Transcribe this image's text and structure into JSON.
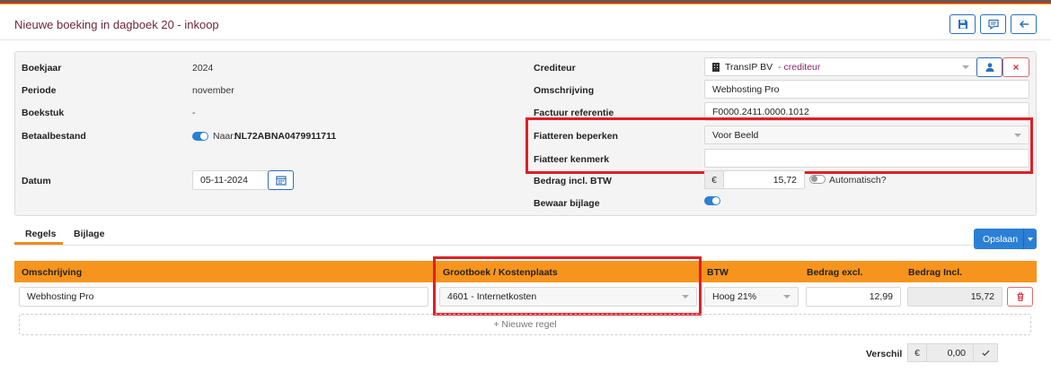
{
  "header": {
    "title": "Nieuwe boeking in dagboek 20  - inkoop"
  },
  "form": {
    "boekjaar": {
      "label": "Boekjaar",
      "value": "2024"
    },
    "periode": {
      "label": "Periode",
      "value": "november"
    },
    "boekstuk": {
      "label": "Boekstuk",
      "value": "-"
    },
    "betaalbestand": {
      "label": "Betaalbestand",
      "prefix": "Naar:",
      "value": "NL72ABNA0479911711"
    },
    "datum": {
      "label": "Datum",
      "value": "05-11-2024"
    },
    "crediteur": {
      "label": "Crediteur",
      "name": "TransIP BV",
      "suffix": "- crediteur"
    },
    "omschrijving": {
      "label": "Omschrijving",
      "value": "Webhosting Pro"
    },
    "factuur_referentie": {
      "label": "Factuur referentie",
      "value": "F0000.2411.0000.1012"
    },
    "fiatteren_beperken": {
      "label": "Fiatteren beperken",
      "value": "Voor Beeld"
    },
    "fiatteer_kenmerk": {
      "label": "Fiatteer kenmerk",
      "value": ""
    },
    "bedrag_incl_btw": {
      "label": "Bedrag incl. BTW",
      "currency": "€",
      "value": "15,72",
      "auto_label": "Automatisch?"
    },
    "bewaar_bijlage": {
      "label": "Bewaar bijlage"
    }
  },
  "tabs": [
    {
      "label": "Regels"
    },
    {
      "label": "Bijlage"
    }
  ],
  "save_button": {
    "label": "Opslaan"
  },
  "table": {
    "columns": [
      "Omschrijving",
      "Grootboek / Kostenplaats",
      "BTW",
      "Bedrag excl.",
      "Bedrag Incl."
    ],
    "rows": [
      {
        "omschrijving": "Webhosting Pro",
        "grootboek": "4601  - Internetkosten",
        "btw": "Hoog 21%",
        "bedrag_excl": "12,99",
        "bedrag_incl": "15,72"
      }
    ],
    "new_row_label": "+ Nieuwe regel"
  },
  "verschil": {
    "label": "Verschil",
    "currency": "€",
    "value": "0,00"
  },
  "colors": {
    "title": "#6b2741",
    "accent": "#2b7fd4",
    "table_header": "#f7941d",
    "highlight": "#e01e26"
  }
}
